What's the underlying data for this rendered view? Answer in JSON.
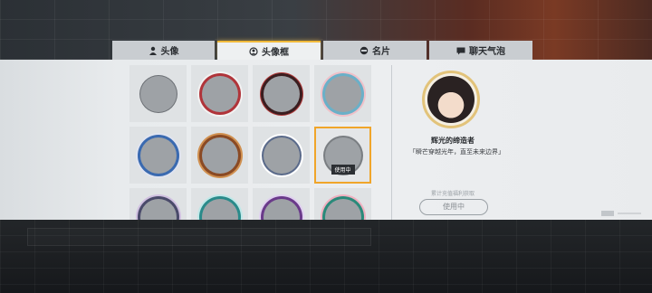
{
  "tabs": [
    {
      "label": "头像",
      "icon": "person-icon",
      "active": false
    },
    {
      "label": "头像框",
      "icon": "avatar-frame-icon",
      "active": true
    },
    {
      "label": "名片",
      "icon": "card-icon",
      "active": false
    },
    {
      "label": "聊天气泡",
      "icon": "chat-bubble-icon",
      "active": false
    }
  ],
  "grid": {
    "selected_index": 7,
    "in_use_label": "使用中"
  },
  "detail": {
    "name": "辉光的缔造者",
    "description": "「瞬芒穿越光年，直至未来边界」",
    "source": "累计充值福利获取",
    "button_label": "使用中"
  },
  "colors": {
    "accent": "#f0a52a",
    "tab_active_top": "#f0b93a",
    "panel_bg": "#eceef0"
  }
}
